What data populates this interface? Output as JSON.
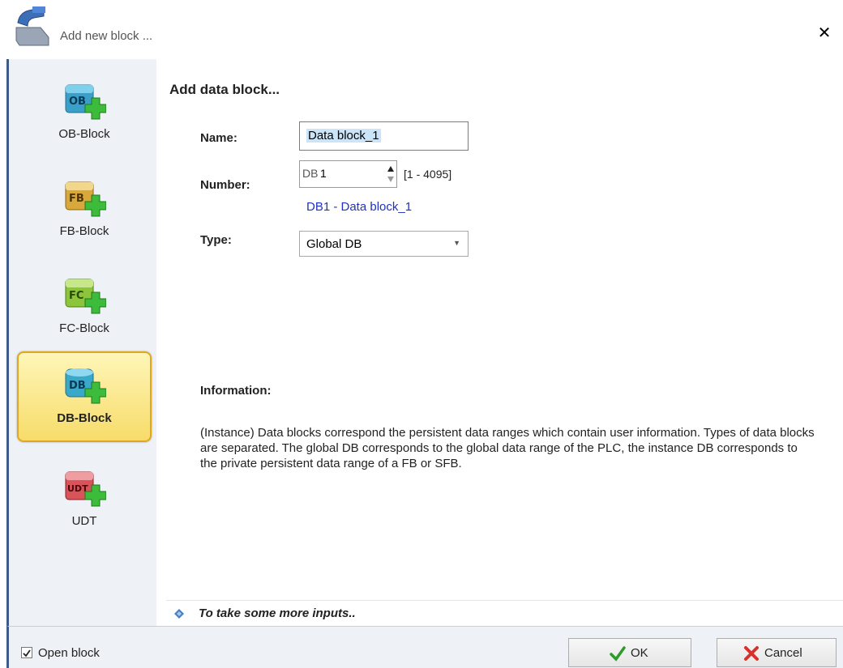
{
  "window": {
    "title": "Add new block ...",
    "close_glyph": "✕"
  },
  "sidebar": {
    "items": [
      {
        "label": "OB-Block",
        "icon_text": "OB",
        "color": "#3aa0c9",
        "selected": false
      },
      {
        "label": "FB-Block",
        "icon_text": "FB",
        "color": "#d8a83a",
        "selected": false
      },
      {
        "label": "FC-Block",
        "icon_text": "FC",
        "color": "#8cc43a",
        "selected": false
      },
      {
        "label": "DB-Block",
        "icon_text": "DB",
        "color": "#3aa8c9",
        "selected": true
      },
      {
        "label": "UDT",
        "icon_text": "UDT",
        "color": "#d9545a",
        "selected": false
      }
    ]
  },
  "form": {
    "heading": "Add data block...",
    "name_label": "Name:",
    "name_value": "Data block_1",
    "number_label": "Number:",
    "number_prefix": "DB",
    "number_value": "1",
    "number_range": "[1 - 4095]",
    "block_link": "DB1 - Data block_1",
    "type_label": "Type:",
    "type_value": "Global DB"
  },
  "info": {
    "title": "Information:",
    "text": "(Instance) Data blocks correspond the persistent data ranges which contain user information. Types of data blocks are separated. The global DB corresponds to the global data range of the PLC, the instance DB corresponds to the private persistent data range of a FB or SFB."
  },
  "more_inputs": "To take some more inputs..",
  "footer": {
    "open_block_label": "Open block",
    "open_block_checked": true,
    "ok_label": "OK",
    "cancel_label": "Cancel"
  },
  "colors": {
    "frame_accent": "#3d5a8a",
    "selected_bg": "#f7dc6a",
    "link": "#1f33c4"
  }
}
